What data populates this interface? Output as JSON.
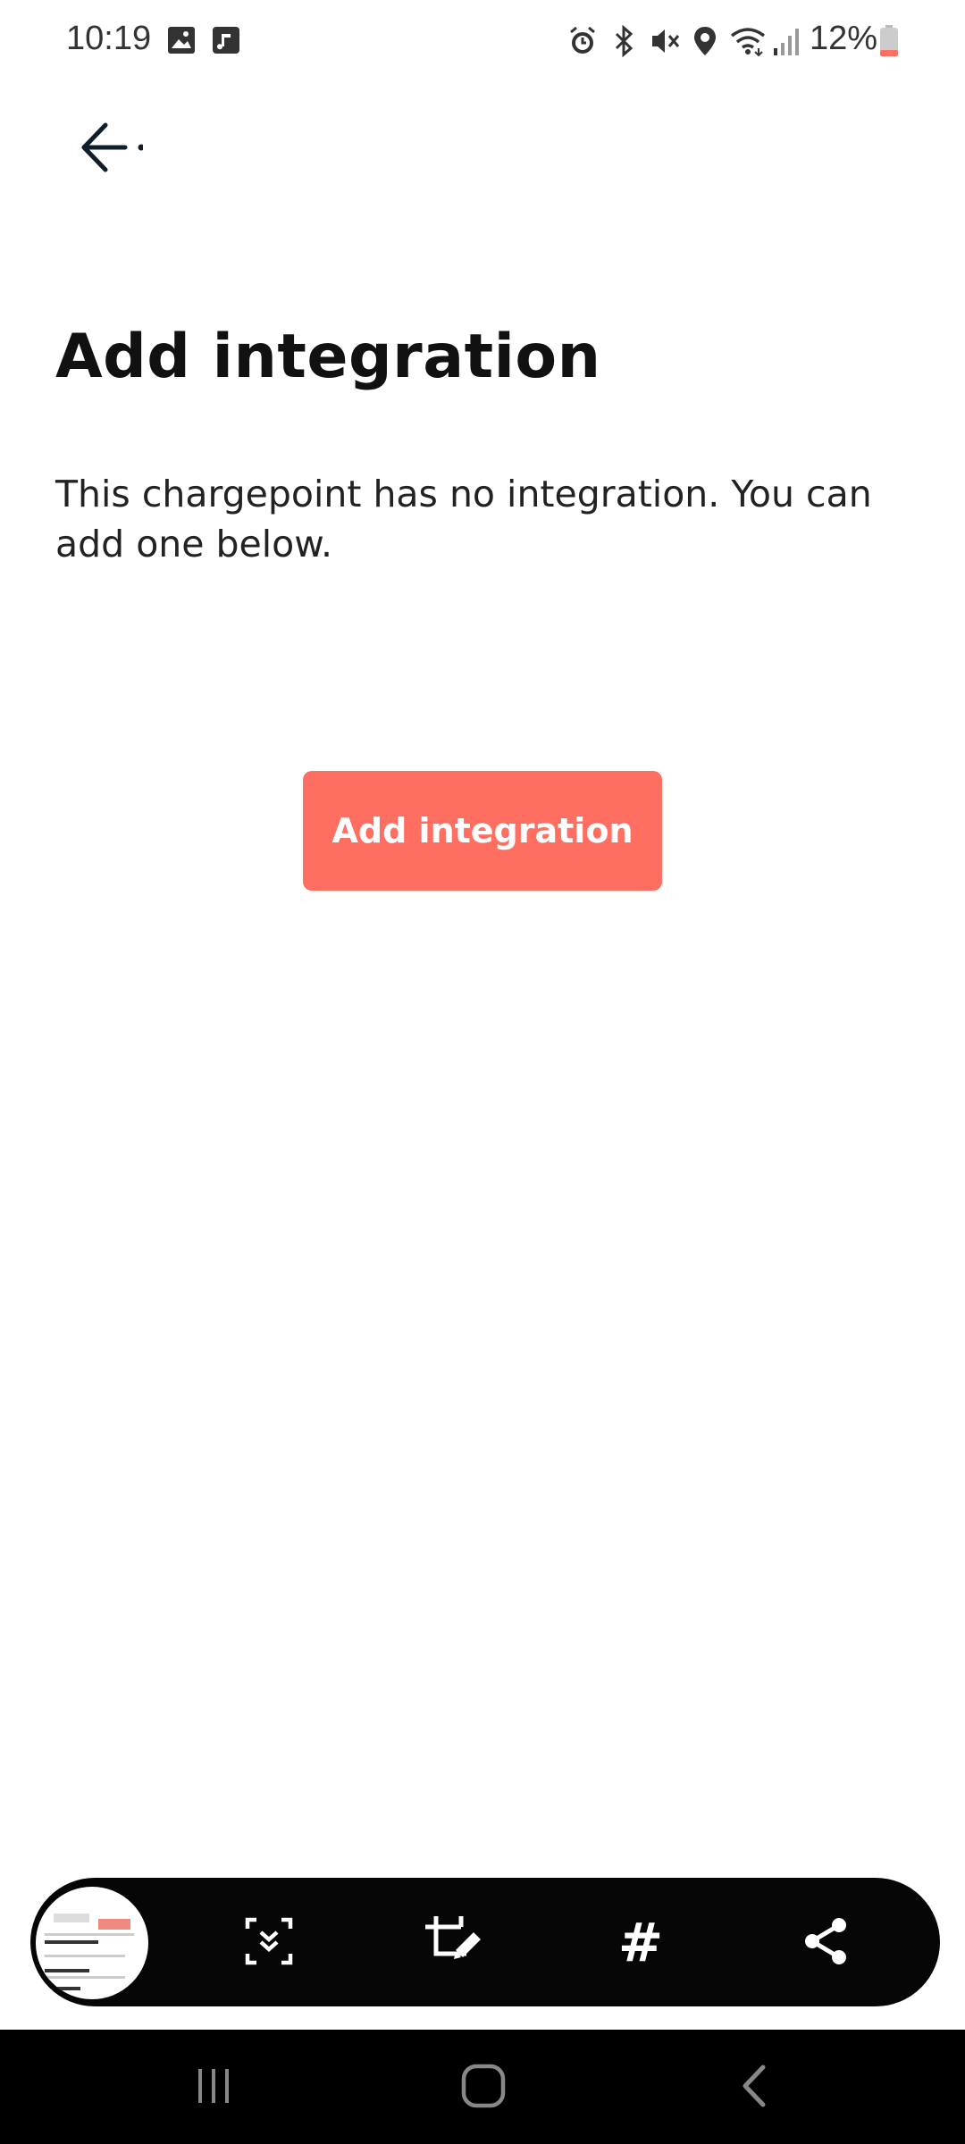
{
  "status_bar": {
    "time": "10:19",
    "battery": "12%",
    "icons": [
      "image-icon",
      "music-note-icon",
      "alarm-icon",
      "bluetooth-icon",
      "vibrate-icon",
      "location-icon",
      "wifi-icon",
      "signal-icon",
      "battery-icon"
    ]
  },
  "header": {
    "back_icon": "arrow-left-icon"
  },
  "main": {
    "title": "Add integration",
    "description": "This chargepoint has no integration. You can add one below.",
    "button_label": "Add integration"
  },
  "colors": {
    "accent": "#ff6f61",
    "toolbar_bg": "#060606",
    "nav_bg": "#000000"
  },
  "capture_toolbar": {
    "items": [
      "screenshot-thumbnail",
      "scroll-capture-icon",
      "crop-edit-icon",
      "hashtag-icon",
      "share-icon"
    ],
    "hashtag_label": "#"
  },
  "nav_bar": {
    "items": [
      "recent-apps-icon",
      "home-icon",
      "back-icon"
    ]
  }
}
